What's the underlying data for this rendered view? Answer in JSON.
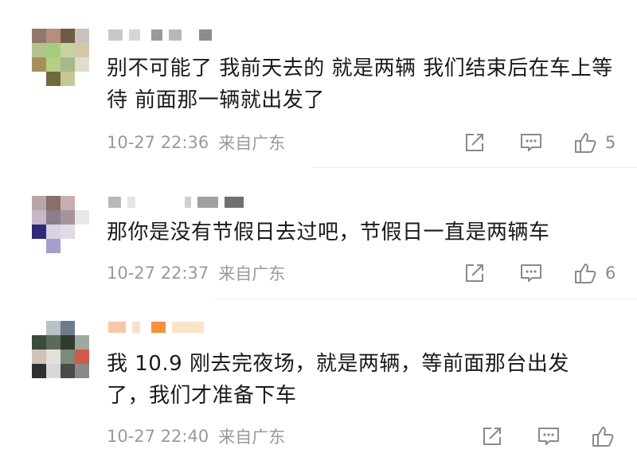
{
  "comments": [
    {
      "text": "别不可能了 我前天去的 就是两辆 我们结束后在车上等待 前面那一辆就出发了",
      "time": "10-27 22:36",
      "location": "来自广东",
      "likes": "5",
      "icons": [
        "share-icon",
        "comment-icon",
        "thumbs-up-icon"
      ]
    },
    {
      "text": "那你是没有节假日去过吧，节假日一直是两辆车",
      "time": "10-27 22:37",
      "location": "来自广东",
      "likes": "6",
      "icons": [
        "share-icon",
        "comment-icon",
        "thumbs-up-icon"
      ]
    },
    {
      "text": "我 10.9 刚去完夜场，就是两辆，等前面那台出发了，我们才准备下车",
      "time": "10-27 22:40",
      "location": "来自广东",
      "likes": "",
      "icons": [
        "share-icon",
        "comment-icon",
        "thumbs-up-icon"
      ]
    }
  ]
}
